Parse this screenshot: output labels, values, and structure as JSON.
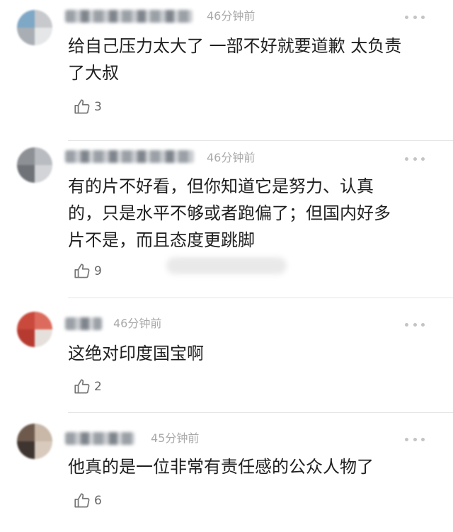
{
  "comments": [
    {
      "time": "46分钟前",
      "text": "给自己压力太大了 一部不好就要道歉 太负责\n了大叔",
      "likes": "3",
      "avatar_colors": [
        "#7fa7c6",
        "#c7c9cc",
        "#a8aeb4",
        "#e4e6e8"
      ]
    },
    {
      "time": "46分钟前",
      "text": "有的片不好看，但你知道它是努力、认真\n的，只是水平不够或者跑偏了；但国内好多\n片不是，而且态度更跳脚",
      "likes": "9",
      "avatar_colors": [
        "#8d9095",
        "#b9bcc0",
        "#6f7378",
        "#d2d4d7"
      ]
    },
    {
      "time": "46分钟前",
      "text": "这绝对印度国宝啊",
      "likes": "2",
      "avatar_colors": [
        "#c94a3c",
        "#dd6b5d",
        "#b63a30",
        "#e6e0dc"
      ]
    },
    {
      "time": "45分钟前",
      "text": "他真的是一位非常有责任感的公众人物了",
      "likes": "6",
      "avatar_colors": [
        "#6e5a4c",
        "#c9b8a8",
        "#3f3530",
        "#d8cabd"
      ]
    }
  ]
}
